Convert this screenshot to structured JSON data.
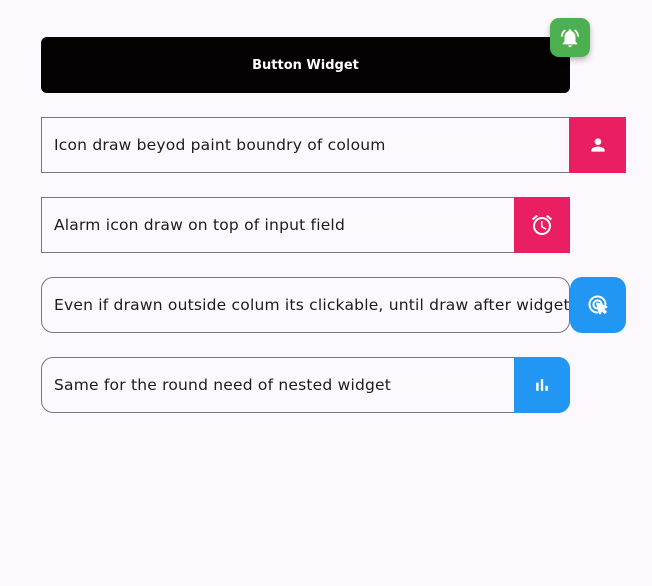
{
  "main_button": {
    "label": "Button Widget"
  },
  "fab": {
    "icon": "notifications-active-icon",
    "color": "#4caf50"
  },
  "rows": [
    {
      "text": "Icon draw beyod paint boundry of coloum",
      "icon": "person-icon",
      "color": "#e91e63"
    },
    {
      "text": "Alarm icon draw on top of input field",
      "icon": "alarm-icon",
      "color": "#e91e63"
    },
    {
      "text": "Even if drawn outside colum its clickable, until draw after widget",
      "icon": "touch-icon",
      "color": "#2196f3"
    },
    {
      "text": "Same for the round need of nested widget",
      "icon": "bar-chart-icon",
      "color": "#2196f3"
    }
  ]
}
